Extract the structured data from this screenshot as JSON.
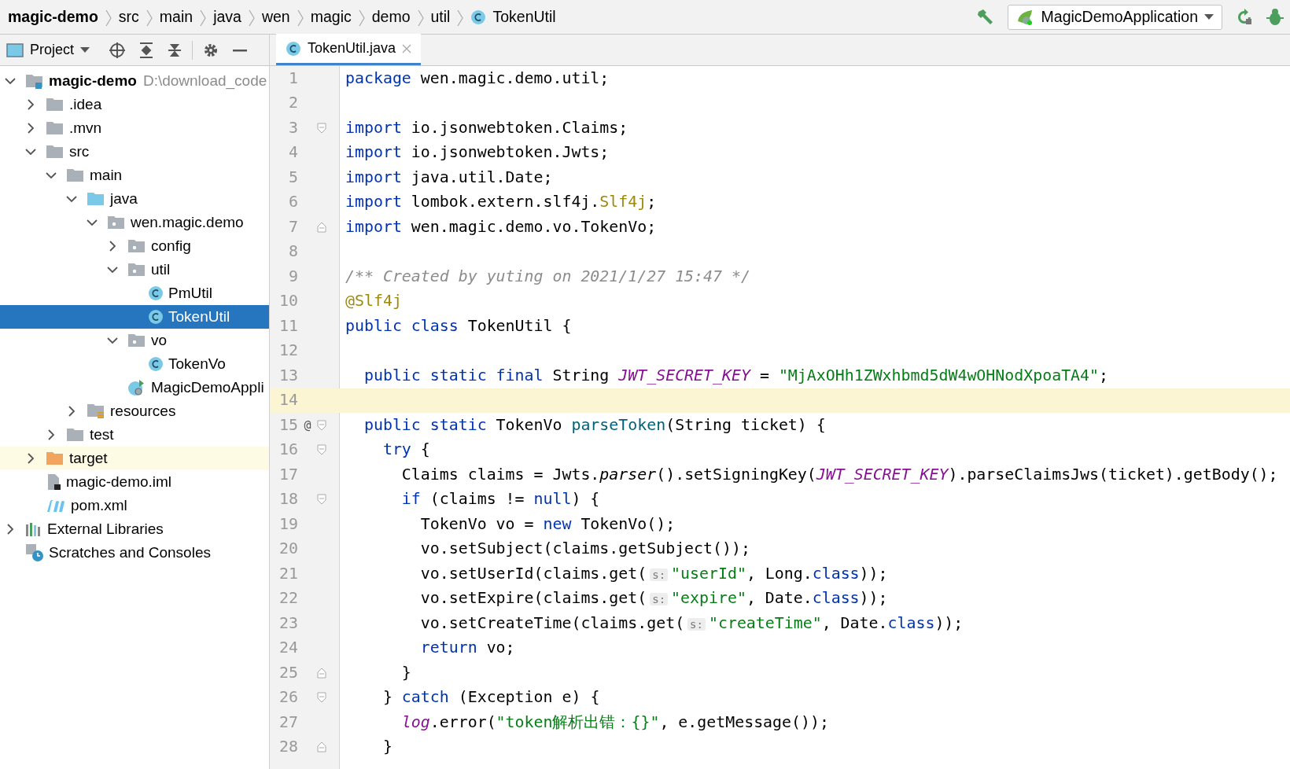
{
  "breadcrumbs": [
    {
      "label": "magic-demo",
      "kind": "project"
    },
    {
      "label": "src",
      "kind": "folder"
    },
    {
      "label": "main",
      "kind": "folder"
    },
    {
      "label": "java",
      "kind": "folder"
    },
    {
      "label": "wen",
      "kind": "folder"
    },
    {
      "label": "magic",
      "kind": "folder"
    },
    {
      "label": "demo",
      "kind": "folder"
    },
    {
      "label": "util",
      "kind": "folder"
    },
    {
      "label": "TokenUtil",
      "kind": "class"
    }
  ],
  "run_config": {
    "label": "MagicDemoApplication"
  },
  "project_panel": {
    "title": "Project",
    "tree": [
      {
        "label": "magic-demo",
        "path": "D:\\download_code",
        "kind": "module",
        "expanded": true,
        "selected": false,
        "highlighted": false,
        "children": [
          {
            "label": ".idea",
            "kind": "folder",
            "expanded": false,
            "selected": false,
            "highlighted": false
          },
          {
            "label": ".mvn",
            "kind": "folder",
            "expanded": false,
            "selected": false,
            "highlighted": false
          },
          {
            "label": "src",
            "kind": "folder",
            "expanded": true,
            "selected": false,
            "highlighted": false,
            "children": [
              {
                "label": "main",
                "kind": "folder",
                "expanded": true,
                "selected": false,
                "highlighted": false,
                "children": [
                  {
                    "label": "java",
                    "kind": "source-folder",
                    "expanded": true,
                    "selected": false,
                    "highlighted": false,
                    "children": [
                      {
                        "label": "wen.magic.demo",
                        "kind": "package",
                        "expanded": true,
                        "selected": false,
                        "highlighted": false,
                        "children": [
                          {
                            "label": "config",
                            "kind": "package",
                            "expanded": false,
                            "selected": false,
                            "highlighted": false
                          },
                          {
                            "label": "util",
                            "kind": "package",
                            "expanded": true,
                            "selected": false,
                            "highlighted": false,
                            "children": [
                              {
                                "label": "PmUtil",
                                "kind": "class",
                                "selected": false,
                                "highlighted": false
                              },
                              {
                                "label": "TokenUtil",
                                "kind": "class",
                                "selected": true,
                                "highlighted": false
                              }
                            ]
                          },
                          {
                            "label": "vo",
                            "kind": "package",
                            "expanded": true,
                            "selected": false,
                            "highlighted": false,
                            "children": [
                              {
                                "label": "TokenVo",
                                "kind": "class",
                                "selected": false,
                                "highlighted": false
                              }
                            ]
                          },
                          {
                            "label": "MagicDemoAppli",
                            "kind": "app",
                            "selected": false,
                            "highlighted": false
                          }
                        ]
                      }
                    ]
                  },
                  {
                    "label": "resources",
                    "kind": "resources",
                    "expanded": false,
                    "selected": false,
                    "highlighted": false
                  }
                ]
              },
              {
                "label": "test",
                "kind": "folder",
                "expanded": false,
                "selected": false,
                "highlighted": false
              }
            ]
          },
          {
            "label": "target",
            "kind": "excluded",
            "expanded": false,
            "selected": false,
            "highlighted": true
          },
          {
            "label": "magic-demo.iml",
            "kind": "iml",
            "selected": false,
            "highlighted": false
          },
          {
            "label": "pom.xml",
            "kind": "maven",
            "selected": false,
            "highlighted": false
          }
        ]
      },
      {
        "label": "External Libraries",
        "kind": "libraries",
        "expanded": false,
        "selected": false,
        "highlighted": false
      },
      {
        "label": "Scratches and Consoles",
        "kind": "scratches",
        "selected": false,
        "highlighted": false
      }
    ]
  },
  "tabs": [
    {
      "label": "TokenUtil.java",
      "selected": true
    }
  ],
  "editor": {
    "lines": [
      {
        "number": "1",
        "current": false,
        "segments": [
          {
            "kind": "keyword",
            "text": "package"
          },
          {
            "kind": "plain",
            "text": " wen.magic.demo.util;"
          }
        ]
      },
      {
        "number": "2",
        "current": false
      },
      {
        "number": "3",
        "current": false,
        "fold_start": true,
        "fold_end": false,
        "segments": [
          {
            "kind": "keyword",
            "text": "import"
          },
          {
            "kind": "plain",
            "text": " io.jsonwebtoken.Claims;"
          }
        ]
      },
      {
        "number": "4",
        "current": false,
        "segments": [
          {
            "kind": "keyword",
            "text": "import"
          },
          {
            "kind": "plain",
            "text": " io.jsonwebtoken.Jwts;"
          }
        ]
      },
      {
        "number": "5",
        "current": false,
        "segments": [
          {
            "kind": "keyword",
            "text": "import"
          },
          {
            "kind": "plain",
            "text": " java.util.Date;"
          }
        ]
      },
      {
        "number": "6",
        "current": false,
        "segments": [
          {
            "kind": "keyword",
            "text": "import"
          },
          {
            "kind": "plain",
            "text": " lombok.extern.slf4j."
          },
          {
            "kind": "annotation",
            "text": "Slf4j"
          },
          {
            "kind": "plain",
            "text": ";"
          }
        ]
      },
      {
        "number": "7",
        "current": false,
        "fold_start": false,
        "fold_end": true,
        "segments": [
          {
            "kind": "keyword",
            "text": "import"
          },
          {
            "kind": "plain",
            "text": " wen.magic.demo.vo.TokenVo;"
          }
        ]
      },
      {
        "number": "8",
        "current": false
      },
      {
        "number": "9",
        "current": false,
        "segments": [
          {
            "kind": "comment",
            "text": "/** Created by yuting on 2021/1/27 15:47 */"
          }
        ]
      },
      {
        "number": "10",
        "current": false,
        "segments": [
          {
            "kind": "annotation",
            "text": "@Slf4j"
          }
        ]
      },
      {
        "number": "11",
        "current": false,
        "segments": [
          {
            "kind": "keyword",
            "text": "public class"
          },
          {
            "kind": "plain",
            "text": " TokenUtil {"
          }
        ]
      },
      {
        "number": "12",
        "current": false
      },
      {
        "number": "13",
        "current": false,
        "segments": [
          {
            "kind": "keyword",
            "text": "  public static final"
          },
          {
            "kind": "plain",
            "text": " String "
          },
          {
            "kind": "constant",
            "text": "JWT_SECRET_KEY"
          },
          {
            "kind": "plain",
            "text": " = "
          },
          {
            "kind": "string",
            "text": "\"MjAxOHh1ZWxhbmd5dW4wOHNodXpoaTA4\""
          },
          {
            "kind": "plain",
            "text": ";"
          }
        ]
      },
      {
        "number": "14",
        "current": true
      },
      {
        "number": "15",
        "current": false,
        "fold_start": true,
        "fold_end": false,
        "marker": "@",
        "segments": [
          {
            "kind": "keyword",
            "text": "  public static"
          },
          {
            "kind": "plain",
            "text": " TokenVo "
          },
          {
            "kind": "method",
            "text": "parseToken"
          },
          {
            "kind": "plain",
            "text": "(String ticket) {"
          }
        ]
      },
      {
        "number": "16",
        "current": false,
        "fold_start": true,
        "fold_end": false,
        "segments": [
          {
            "kind": "keyword",
            "text": "    try"
          },
          {
            "kind": "plain",
            "text": " {"
          }
        ]
      },
      {
        "number": "17",
        "current": false,
        "segments": [
          {
            "kind": "plain",
            "text": "      Claims claims = Jwts."
          },
          {
            "kind": "static",
            "text": "parser"
          },
          {
            "kind": "plain",
            "text": "().setSigningKey("
          },
          {
            "kind": "constant",
            "text": "JWT_SECRET_KEY"
          },
          {
            "kind": "plain",
            "text": ").parseClaimsJws(ticket).getBody();"
          }
        ]
      },
      {
        "number": "18",
        "current": false,
        "fold_start": true,
        "fold_end": false,
        "segments": [
          {
            "kind": "keyword",
            "text": "      if"
          },
          {
            "kind": "plain",
            "text": " (claims != "
          },
          {
            "kind": "keyword",
            "text": "null"
          },
          {
            "kind": "plain",
            "text": ") {"
          }
        ]
      },
      {
        "number": "19",
        "current": false,
        "segments": [
          {
            "kind": "plain",
            "text": "        TokenVo vo = "
          },
          {
            "kind": "keyword",
            "text": "new"
          },
          {
            "kind": "plain",
            "text": " TokenVo();"
          }
        ]
      },
      {
        "number": "20",
        "current": false,
        "segments": [
          {
            "kind": "plain",
            "text": "        vo.setSubject(claims.getSubject());"
          }
        ]
      },
      {
        "number": "21",
        "current": false,
        "segments": [
          {
            "kind": "plain",
            "text": "        vo.setUserId(claims.get("
          },
          {
            "kind": "hint",
            "text": "s:"
          },
          {
            "kind": "string",
            "text": "\"userId\""
          },
          {
            "kind": "plain",
            "text": ", Long."
          },
          {
            "kind": "keyword",
            "text": "class"
          },
          {
            "kind": "plain",
            "text": "));"
          }
        ]
      },
      {
        "number": "22",
        "current": false,
        "segments": [
          {
            "kind": "plain",
            "text": "        vo.setExpire(claims.get("
          },
          {
            "kind": "hint",
            "text": "s:"
          },
          {
            "kind": "string",
            "text": "\"expire\""
          },
          {
            "kind": "plain",
            "text": ", Date."
          },
          {
            "kind": "keyword",
            "text": "class"
          },
          {
            "kind": "plain",
            "text": "));"
          }
        ]
      },
      {
        "number": "23",
        "current": false,
        "segments": [
          {
            "kind": "plain",
            "text": "        vo.setCreateTime(claims.get("
          },
          {
            "kind": "hint",
            "text": "s:"
          },
          {
            "kind": "string",
            "text": "\"createTime\""
          },
          {
            "kind": "plain",
            "text": ", Date."
          },
          {
            "kind": "keyword",
            "text": "class"
          },
          {
            "kind": "plain",
            "text": "));"
          }
        ]
      },
      {
        "number": "24",
        "current": false,
        "segments": [
          {
            "kind": "keyword",
            "text": "        return"
          },
          {
            "kind": "plain",
            "text": " vo;"
          }
        ]
      },
      {
        "number": "25",
        "current": false,
        "fold_start": false,
        "fold_end": true,
        "segments": [
          {
            "kind": "plain",
            "text": "      }"
          }
        ]
      },
      {
        "number": "26",
        "current": false,
        "fold_start": true,
        "fold_end": false,
        "segments": [
          {
            "kind": "plain",
            "text": "    } "
          },
          {
            "kind": "keyword",
            "text": "catch"
          },
          {
            "kind": "plain",
            "text": " (Exception e) {"
          }
        ]
      },
      {
        "number": "27",
        "current": false,
        "segments": [
          {
            "kind": "constant",
            "text": "      log"
          },
          {
            "kind": "plain",
            "text": ".error("
          },
          {
            "kind": "string",
            "text": "\"token解析出错：{}\""
          },
          {
            "kind": "plain",
            "text": ", e.getMessage());"
          }
        ]
      },
      {
        "number": "28",
        "current": false,
        "fold_start": false,
        "fold_end": true,
        "segments": [
          {
            "kind": "plain",
            "text": "    }"
          }
        ]
      }
    ]
  }
}
